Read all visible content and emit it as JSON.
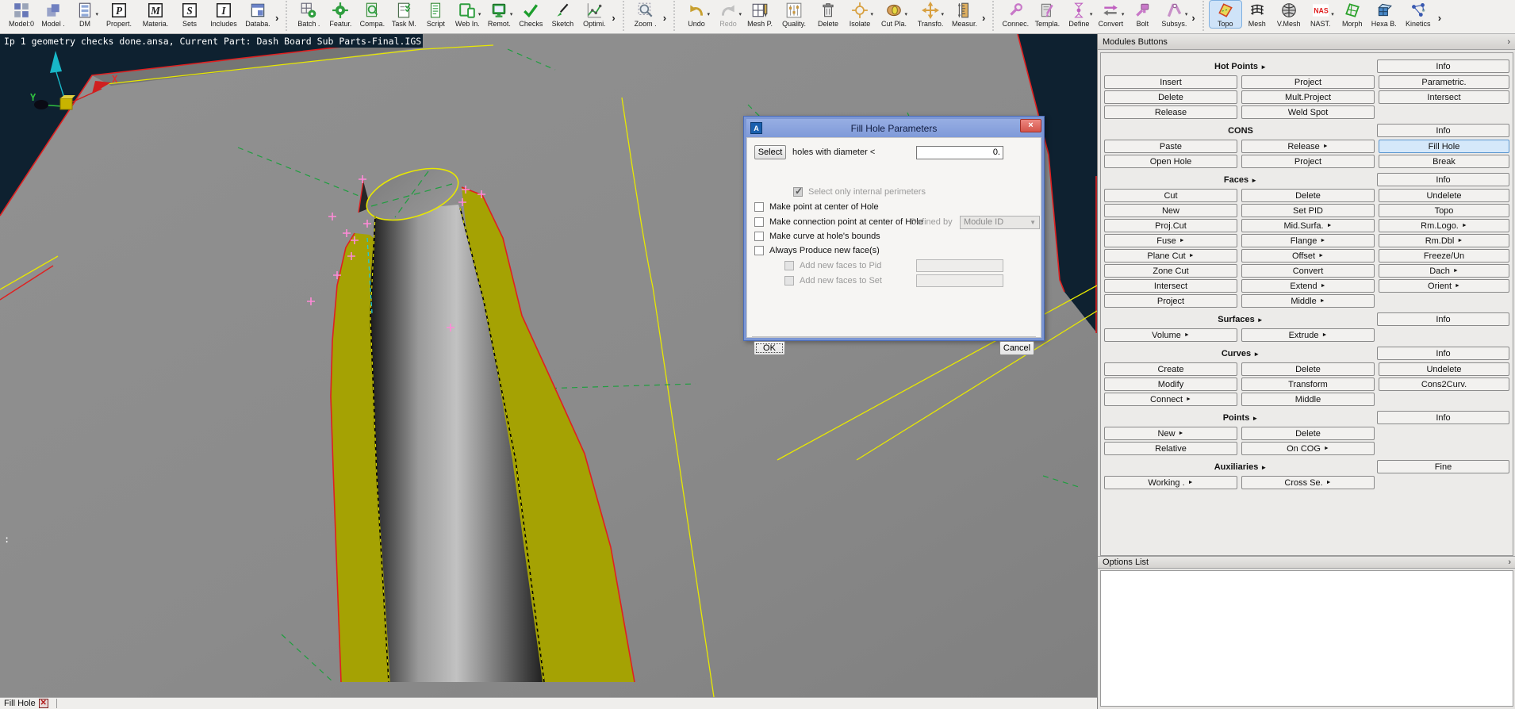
{
  "toolbar": {
    "groups": [
      {
        "items": [
          {
            "label": "Model:0",
            "icon": "grid",
            "color": "#6878b8"
          },
          {
            "label": "Model .",
            "icon": "puzzle",
            "color": "#7080c0"
          },
          {
            "label": "DM",
            "icon": "dm",
            "color": "#8090a8",
            "dropdown": true
          },
          {
            "label": "Propert.",
            "icon": "letterP",
            "color": "#222222"
          },
          {
            "label": "Materia.",
            "icon": "letterM",
            "color": "#222222"
          },
          {
            "label": "Sets",
            "icon": "letterS",
            "color": "#222222"
          },
          {
            "label": "Includes",
            "icon": "letterI",
            "color": "#222222"
          },
          {
            "label": "Databa.",
            "icon": "window",
            "color": "#6c84c8"
          }
        ]
      },
      {
        "items": [
          {
            "label": "Batch .",
            "icon": "batch",
            "color": "#2f9e3f"
          },
          {
            "label": "Featur.",
            "icon": "gear",
            "color": "#2f9e3f"
          },
          {
            "label": "Compa.",
            "icon": "magdoc",
            "color": "#2f9e3f"
          },
          {
            "label": "Task M.",
            "icon": "task",
            "color": "#2f9e3f"
          },
          {
            "label": "Script",
            "icon": "script",
            "color": "#2f9e3f"
          },
          {
            "label": "Web In.",
            "icon": "webin",
            "color": "#2f9e3f",
            "dropdown": true
          },
          {
            "label": "Remot.",
            "icon": "monitor",
            "color": "#2f9e3f",
            "dropdown": true
          },
          {
            "label": "Checks",
            "icon": "check",
            "color": "#1d9e2d"
          },
          {
            "label": "Sketch",
            "icon": "brush",
            "color": "#2f9e3f"
          },
          {
            "label": "Optimi.",
            "icon": "chart",
            "color": "#2f9e3f"
          }
        ]
      },
      {
        "items": [
          {
            "label": "Zoom .",
            "icon": "magnifier",
            "color": "#6a7a8a"
          }
        ]
      },
      {
        "items": [
          {
            "label": "Undo",
            "icon": "undo",
            "color": "#c8a030",
            "dropdown": true
          },
          {
            "label": "Redo",
            "icon": "redo",
            "color": "#c0c0c0",
            "dropdown": true,
            "disabled": true
          },
          {
            "label": "Mesh P.",
            "icon": "meshpencil",
            "color": "#555555"
          },
          {
            "label": "Quality.",
            "icon": "sliders",
            "color": "#c8953a"
          },
          {
            "label": "Delete",
            "icon": "trash",
            "color": "#888888"
          },
          {
            "label": "Isolate",
            "icon": "crosshair",
            "color": "#d8a040",
            "dropdown": true
          },
          {
            "label": "Cut Pla.",
            "icon": "torus",
            "color": "#d8953a",
            "dropdown": true
          },
          {
            "label": "Transfo.",
            "icon": "move",
            "color": "#d8a040",
            "dropdown": true
          },
          {
            "label": "Measur.",
            "icon": "ruler",
            "color": "#e0b060"
          }
        ]
      },
      {
        "items": [
          {
            "label": "Connec.",
            "icon": "wrench",
            "color": "#c878c8"
          },
          {
            "label": "Templa.",
            "icon": "docpen",
            "color": "#c878c8"
          },
          {
            "label": "Define",
            "icon": "define",
            "color": "#c060c0",
            "dropdown": true
          },
          {
            "label": "Convert",
            "icon": "convert",
            "color": "#c060c0",
            "dropdown": true
          },
          {
            "label": "Bolt",
            "icon": "bolt",
            "color": "#c878c8"
          },
          {
            "label": "Subsys.",
            "icon": "subsys",
            "color": "#c890c8",
            "dropdown": true
          }
        ]
      },
      {
        "items": [
          {
            "label": "Topo",
            "icon": "topo",
            "color": "#e8d858",
            "active": true
          },
          {
            "label": "Mesh",
            "icon": "mesh",
            "color": "#222222"
          },
          {
            "label": "V.Mesh",
            "icon": "vmesh",
            "color": "#444444"
          },
          {
            "label": "NAST.",
            "icon": "nas",
            "color": "#e02020",
            "dropdown": true
          },
          {
            "label": "Morph",
            "icon": "morph",
            "color": "#28a028"
          },
          {
            "label": "Hexa B.",
            "icon": "hexa",
            "color": "#4888c8"
          },
          {
            "label": "Kinetics",
            "icon": "kinetics",
            "color": "#3858b0"
          }
        ]
      }
    ],
    "more_glyph": "›"
  },
  "viewport": {
    "status_text": "Ip 1 geometry checks done.ansa,  Current Part: Dash Board Sub Parts-Final.IGS",
    "cursor_text": ":",
    "axis": {
      "x_label": "X",
      "y_label": "Y"
    }
  },
  "dialog": {
    "title": "Fill Hole Parameters",
    "icon_text": "A",
    "close_glyph": "×",
    "select_button": "Select",
    "diameter_label": "holes with diameter <",
    "diameter_value": "0.",
    "rows": [
      {
        "label": "Select only internal perimeters",
        "checked": true,
        "disabled": true,
        "sub": 1
      },
      {
        "label": "Make point at center of Hole",
        "checked": false,
        "sub": 0
      },
      {
        "label": "Make connection point at center of Hole",
        "checked": false,
        "sub": 0,
        "extra_label": "Defined by",
        "dropdown": "Module ID"
      },
      {
        "label": "Make curve at hole's bounds",
        "checked": false,
        "sub": 0
      },
      {
        "label": "Always Produce new face(s)",
        "checked": false,
        "sub": 0
      },
      {
        "label": "Add new faces to Pid",
        "checked": false,
        "disabled": true,
        "sub": 2,
        "field": true
      },
      {
        "label": "Add new faces to Set",
        "checked": false,
        "disabled": true,
        "sub": 2,
        "field": true
      }
    ],
    "ok": "OK",
    "cancel": "Cancel"
  },
  "sidebar": {
    "title": "Modules Buttons",
    "collapse_glyph": "›",
    "sections": [
      {
        "title": "Hot Points",
        "arrow": true,
        "corner": "Info",
        "rows": [
          [
            "Insert",
            "Project",
            "Parametric."
          ],
          [
            "Delete",
            "Mult.Project",
            "Intersect"
          ],
          [
            "Release",
            "Weld Spot",
            null
          ]
        ]
      },
      {
        "title": "CONS",
        "arrow": false,
        "corner": "Info",
        "rows": [
          [
            "Paste",
            "Release ►",
            {
              "label": "Fill Hole",
              "active": true
            }
          ],
          [
            "Open Hole",
            "Project",
            "Break"
          ]
        ]
      },
      {
        "title": "Faces",
        "arrow": true,
        "corner": "Info",
        "rows": [
          [
            "Cut",
            "Delete",
            "Undelete"
          ],
          [
            "New",
            "Set PID",
            "Topo"
          ],
          [
            "Proj.Cut",
            "Mid.Surfa.►",
            "Rm.Logo.►"
          ],
          [
            "Fuse ►",
            "Flange ►",
            "Rm.Dbl ►"
          ],
          [
            "Plane Cut►",
            "Offset ►",
            "Freeze/Un"
          ],
          [
            "Zone Cut",
            "Convert",
            "Dach ►"
          ],
          [
            "Intersect",
            "Extend ►",
            "Orient ►"
          ],
          [
            "Project",
            "Middle ►",
            null
          ]
        ]
      },
      {
        "title": "Surfaces",
        "arrow": true,
        "corner": "Info",
        "rows": [
          [
            "Volume ►",
            "Extrude ►",
            null
          ]
        ]
      },
      {
        "title": "Curves",
        "arrow": true,
        "corner": "Info",
        "rows": [
          [
            "Create",
            "Delete",
            "Undelete"
          ],
          [
            "Modify",
            "Transform",
            "Cons2Curv."
          ],
          [
            "Connect ►",
            "Middle",
            null
          ]
        ]
      },
      {
        "title": "Points",
        "arrow": true,
        "corner": "Info",
        "rows": [
          [
            "New   ►",
            "Delete",
            null
          ],
          [
            "Relative",
            "On COG ►",
            null
          ]
        ]
      },
      {
        "title": "Auxiliaries",
        "arrow": true,
        "corner": "Fine",
        "rows": [
          [
            "Working . ►",
            "Cross Se.►",
            null
          ]
        ]
      }
    ],
    "options_list": "Options List"
  },
  "bottom_bar": {
    "label": "Fill Hole",
    "close_glyph": "✕"
  },
  "colors": {
    "viewport_bg": "#0e2130",
    "surface_gray": "#8b8b8b",
    "olive_face": "#a5a203",
    "edge_red": "#e02020",
    "edge_yellow": "#e8e800",
    "edge_green": "#1f9e3f",
    "hotpoint_pink": "#ff8ad8",
    "titlebar_blue": "#7f9ad9"
  }
}
